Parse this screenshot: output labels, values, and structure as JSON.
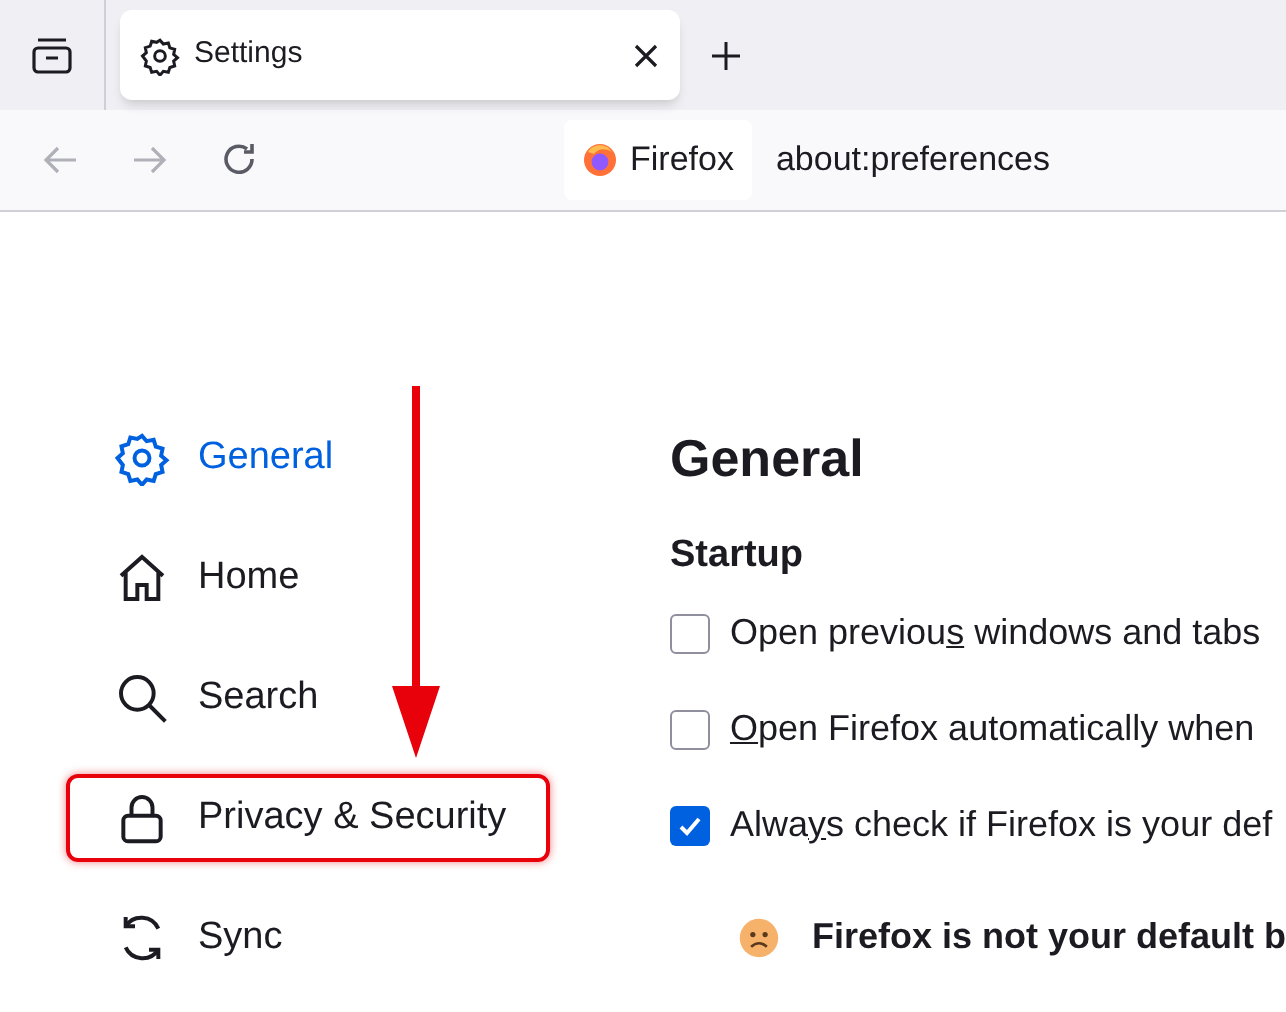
{
  "tab": {
    "title": "Settings",
    "selected": true
  },
  "address_bar": {
    "identity": "Firefox",
    "url": "about:preferences"
  },
  "sidebar": {
    "items": [
      {
        "kind": "gear",
        "label": "General",
        "selected": true,
        "highlighted": false
      },
      {
        "kind": "home",
        "label": "Home",
        "selected": false,
        "highlighted": false
      },
      {
        "kind": "search",
        "label": "Search",
        "selected": false,
        "highlighted": false
      },
      {
        "kind": "lock",
        "label": "Privacy & Security",
        "selected": false,
        "highlighted": true
      },
      {
        "kind": "sync",
        "label": "Sync",
        "selected": false,
        "highlighted": false
      }
    ]
  },
  "page": {
    "title": "General",
    "section": "Startup",
    "options": [
      {
        "label_parts": [
          {
            "text": "Open previou",
            "underlined": false
          },
          {
            "text": "s",
            "underlined": true
          },
          {
            "text": " windows and tabs",
            "underlined": false
          }
        ],
        "checked": false
      },
      {
        "label_parts": [
          {
            "text": "O",
            "underlined": true
          },
          {
            "text": "pen Firefox automatically when",
            "underlined": false
          }
        ],
        "checked": false
      },
      {
        "label_parts": [
          {
            "text": "Alwa",
            "underlined": false
          },
          {
            "text": "y",
            "underlined": true
          },
          {
            "text": "s check if Firefox is your def",
            "underlined": false
          }
        ],
        "checked": true
      }
    ],
    "notice": "Firefox is not your default b"
  }
}
